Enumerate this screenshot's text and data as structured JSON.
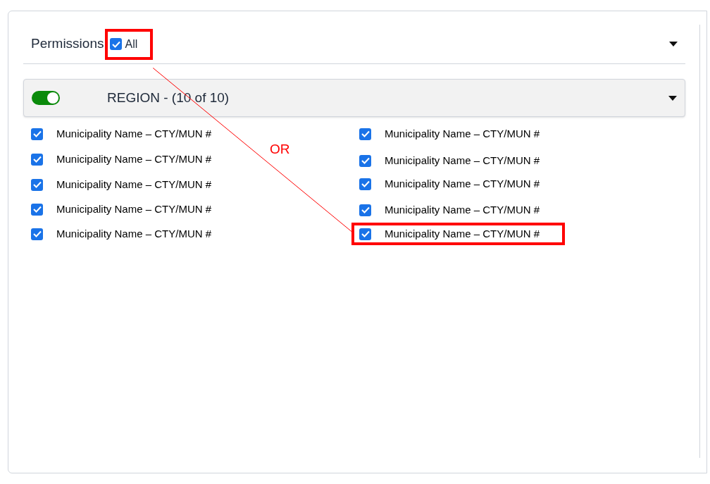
{
  "header": {
    "title": "Permissions",
    "all_checkbox": {
      "label": "All",
      "checked": true,
      "highlighted": true
    },
    "expanded": true
  },
  "region": {
    "label": "REGION - (10 of 10)",
    "on": true,
    "expanded": true
  },
  "columns": [
    [
      {
        "label": "Municipality Name – CTY/MUN #",
        "checked": true,
        "highlighted": false
      },
      {
        "label": "Municipality Name – CTY/MUN #",
        "checked": true,
        "highlighted": false
      },
      {
        "label": "Municipality Name – CTY/MUN #",
        "checked": true,
        "highlighted": false
      },
      {
        "label": "Municipality Name – CTY/MUN #",
        "checked": true,
        "highlighted": false
      },
      {
        "label": "Municipality Name – CTY/MUN #",
        "checked": true,
        "highlighted": false
      }
    ],
    [
      {
        "label": "Municipality Name – CTY/MUN #",
        "checked": true,
        "highlighted": false
      },
      {
        "label": "Municipality Name – CTY/MUN #",
        "checked": true,
        "highlighted": false
      },
      {
        "label": "Municipality Name – CTY/MUN #",
        "checked": true,
        "highlighted": false
      },
      {
        "label": "Municipality Name – CTY/MUN #",
        "checked": true,
        "highlighted": false
      },
      {
        "label": "Municipality Name – CTY/MUN #",
        "checked": true,
        "highlighted": true
      }
    ]
  ],
  "annotation": {
    "note": "OR"
  }
}
